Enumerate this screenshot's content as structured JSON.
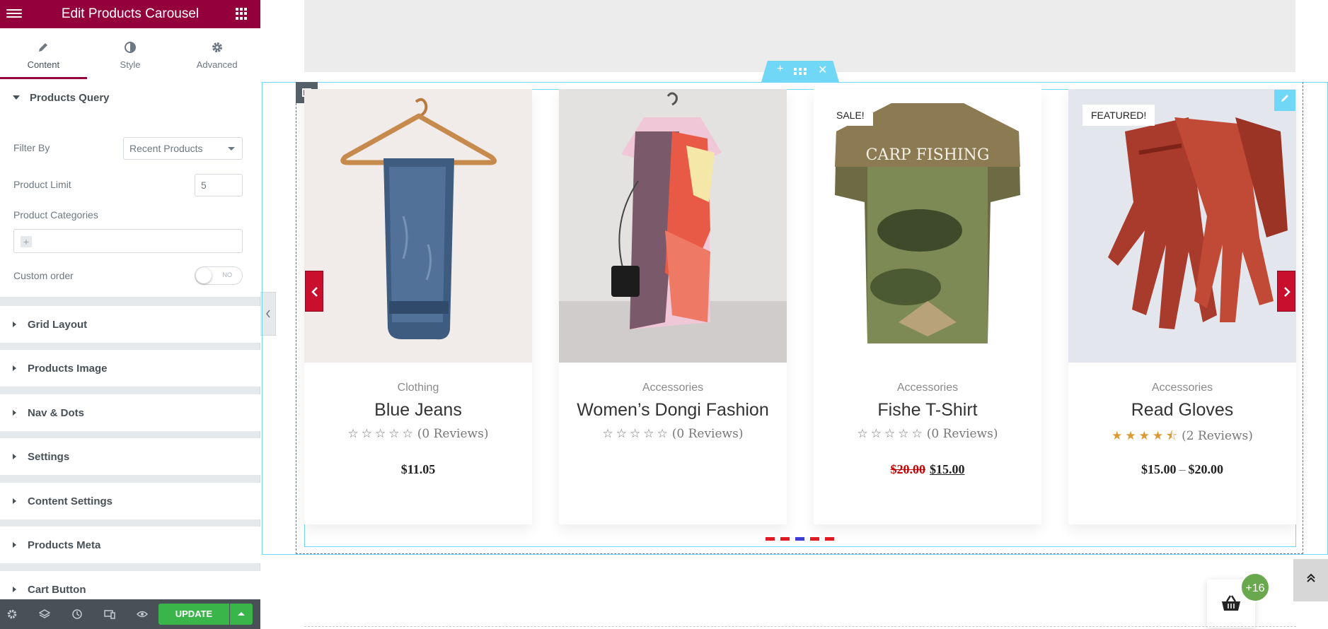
{
  "panel": {
    "title": "Edit Products Carousel",
    "tabs": [
      {
        "label": "Content",
        "icon": "pencil-icon"
      },
      {
        "label": "Style",
        "icon": "half-circle-icon"
      },
      {
        "label": "Advanced",
        "icon": "gear-icon"
      }
    ],
    "query": {
      "title": "Products Query",
      "filter_by_label": "Filter By",
      "filter_by_value": "Recent Products",
      "product_limit_label": "Product Limit",
      "product_limit_value": "5",
      "product_categories_label": "Product Categories",
      "custom_order_label": "Custom order",
      "custom_order_toggle": "NO"
    },
    "sections": [
      "Grid Layout",
      "Products Image",
      "Nav & Dots",
      "Settings",
      "Content Settings",
      "Products Meta",
      "Cart Button"
    ],
    "footer": {
      "icons": [
        "gear-icon",
        "layers-icon",
        "history-icon",
        "responsive-icon",
        "eye-icon"
      ],
      "update_label": "UPDATE"
    }
  },
  "carousel": {
    "products": [
      {
        "category": "Clothing",
        "name": "Blue Jeans",
        "rating": 0,
        "reviews": "(0 Reviews)",
        "price": "$11.05",
        "badge": ""
      },
      {
        "category": "Accessories",
        "name": "Women’s Dongi Fashion",
        "rating": 0,
        "reviews": "(0 Reviews)",
        "price": "",
        "badge": ""
      },
      {
        "category": "Accessories",
        "name": "Fishe T-Shirt",
        "rating": 0,
        "reviews": "(0 Reviews)",
        "price_old": "$20.00",
        "price_new": "$15.00",
        "badge": "SALE!"
      },
      {
        "category": "Accessories",
        "name": "Read Gloves",
        "rating": 4.5,
        "reviews": "(2 Reviews)",
        "price_min": "$15.00",
        "price_sep": "–",
        "price_max": "$20.00",
        "badge": "FEATURED!"
      }
    ],
    "tshirt_print": "CARP FISHING",
    "dots": 5,
    "active_dot": 3,
    "colors": {
      "nav": "#c8102e",
      "dot": "#e01b24",
      "dot_active": "#3d3dd6",
      "accent": "#93003c",
      "star": "#dd9933"
    }
  },
  "floating": {
    "cart_count": "+16"
  }
}
